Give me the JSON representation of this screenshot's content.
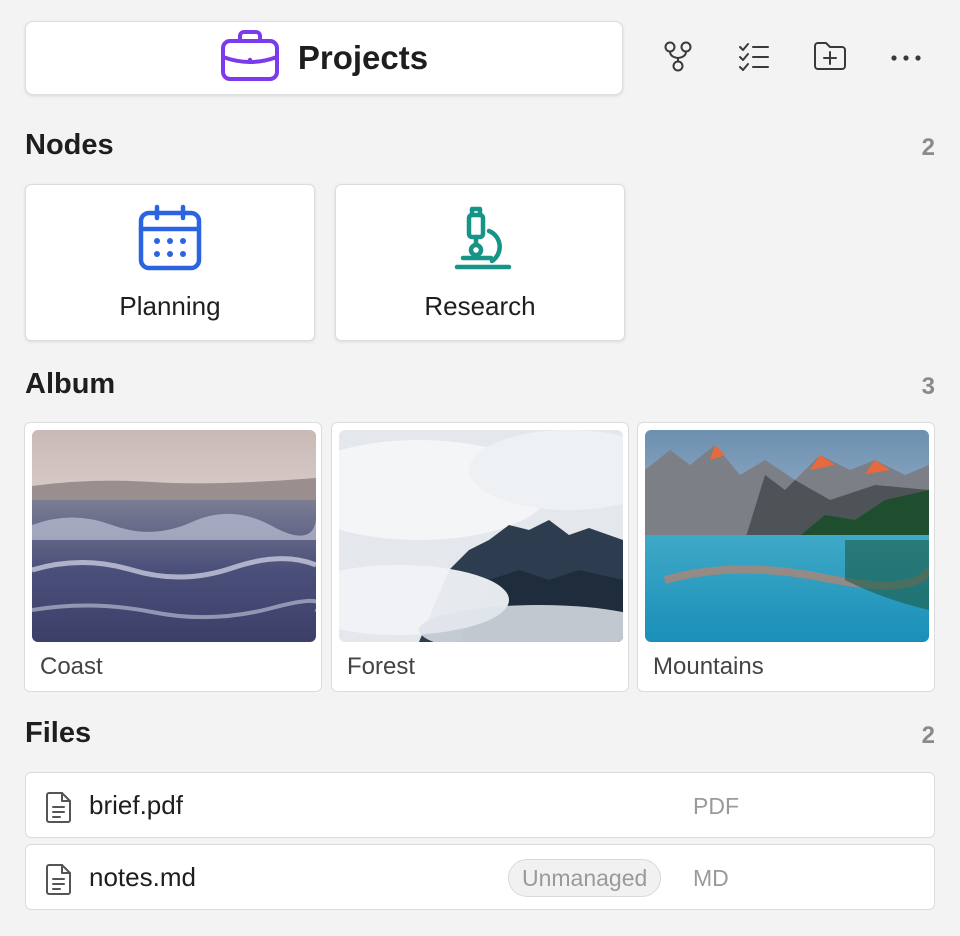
{
  "header": {
    "title": "Projects",
    "icon": "briefcase-icon",
    "accent": "#7c3aed"
  },
  "toolbar": {
    "buttons": [
      {
        "name": "graph-icon"
      },
      {
        "name": "checklist-icon"
      },
      {
        "name": "folder-plus-icon"
      },
      {
        "name": "more-icon"
      }
    ]
  },
  "nodes": {
    "title": "Nodes",
    "count": "2",
    "items": [
      {
        "label": "Planning",
        "icon": "calendar-icon",
        "color": "#2b63e0"
      },
      {
        "label": "Research",
        "icon": "microscope-icon",
        "color": "#169487"
      }
    ]
  },
  "album": {
    "title": "Album",
    "count": "3",
    "items": [
      {
        "caption": "Coast"
      },
      {
        "caption": "Forest"
      },
      {
        "caption": "Mountains"
      }
    ]
  },
  "files": {
    "title": "Files",
    "count": "2",
    "items": [
      {
        "name": "brief.pdf",
        "type": "PDF",
        "badge": ""
      },
      {
        "name": "notes.md",
        "type": "MD",
        "badge": "Unmanaged"
      }
    ]
  }
}
